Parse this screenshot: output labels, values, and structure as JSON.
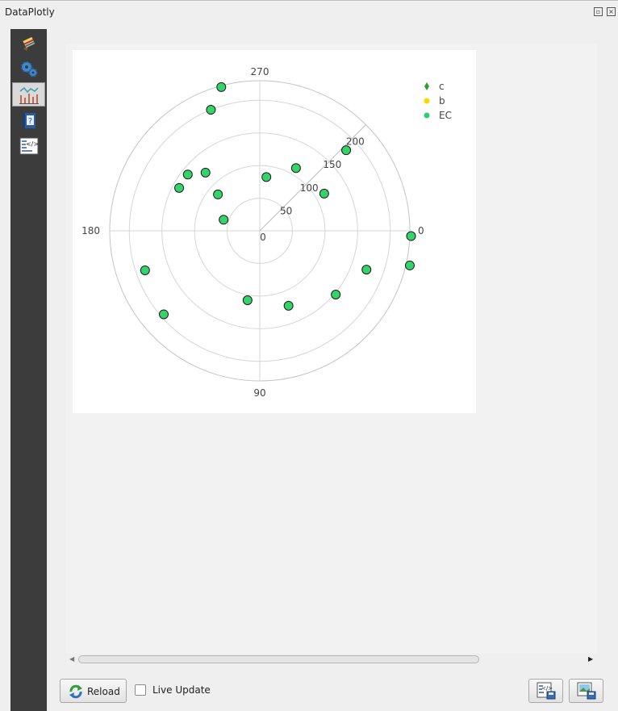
{
  "window": {
    "title": "DataPlotly"
  },
  "sidebar": {
    "items": [
      {
        "icon": "paint-brush-icon"
      },
      {
        "icon": "gears-icon"
      },
      {
        "icon": "plot-icon",
        "active": true
      },
      {
        "icon": "help-book-icon"
      },
      {
        "icon": "code-icon"
      }
    ]
  },
  "chart_data": {
    "type": "scatter",
    "subtype": "polar",
    "angular_ticks": [
      "0",
      "270",
      "180",
      "90"
    ],
    "radial_ticks": [
      "0",
      "50",
      "100",
      "150",
      "200"
    ],
    "radial_range": [
      0,
      230
    ],
    "legend_position": "top-right",
    "legend": [
      {
        "name": "c",
        "marker": "diamond",
        "color": "#2ca02c"
      },
      {
        "name": "b",
        "marker": "circle",
        "color": "#ffd700"
      },
      {
        "name": "EC",
        "marker": "circle",
        "color": "#2ecc71"
      }
    ],
    "series": [
      {
        "name": "EC",
        "color": "#35d46a",
        "points": [
          {
            "theta": 2,
            "r": 232
          },
          {
            "theta": 13,
            "r": 236
          },
          {
            "theta": 20,
            "r": 174
          },
          {
            "theta": 40,
            "r": 152
          },
          {
            "theta": 69,
            "r": 123
          },
          {
            "theta": 100,
            "r": 108
          },
          {
            "theta": 139,
            "r": 195
          },
          {
            "theta": 161,
            "r": 186
          },
          {
            "theta": 197,
            "r": 58
          },
          {
            "theta": 208,
            "r": 140
          },
          {
            "theta": 218,
            "r": 140
          },
          {
            "theta": 221,
            "r": 85
          },
          {
            "theta": 227,
            "r": 122
          },
          {
            "theta": 248,
            "r": 200
          },
          {
            "theta": 255,
            "r": 228
          },
          {
            "theta": 277,
            "r": 83
          },
          {
            "theta": 300,
            "r": 111
          },
          {
            "theta": 330,
            "r": 114
          },
          {
            "theta": 317,
            "r": 181
          }
        ]
      }
    ]
  },
  "toolbar": {
    "reload_label": "Reload",
    "live_update_label": "Live Update",
    "live_update_checked": false
  }
}
